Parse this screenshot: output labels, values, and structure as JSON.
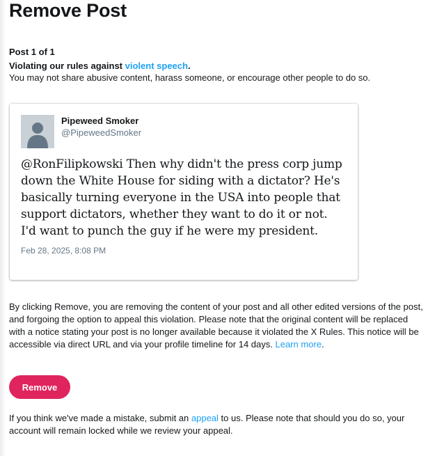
{
  "page": {
    "title": "Remove Post",
    "post_counter": "Post 1 of 1"
  },
  "rule": {
    "prefix": "Violating our rules against ",
    "link_text": "violent speech",
    "suffix": ".",
    "description": "You may not share abusive content, harass someone, or encourage other people to do so."
  },
  "tweet": {
    "author_name": "Pipeweed Smoker",
    "author_handle": "@PipeweedSmoker",
    "text": "@RonFilipkowski Then why didn't the press corp jump down the White House for siding with a dictator? He's basically turning everyone in the USA into people that support dictators, whether they want to do it or not. I'd want to punch the guy if he were my president.",
    "timestamp": "Feb 28, 2025, 8:08 PM",
    "avatar_icon": "default-avatar-icon"
  },
  "explanation": {
    "text": "By clicking Remove, you are removing the content of your post and all other edited versions of the post, and forgoing the option to appeal this violation. Please note that the original content will be replaced with a notice stating your post is no longer available because it violated the X Rules. This notice will be accessible via direct URL and via your profile timeline for 14 days. ",
    "learn_more": "Learn more",
    "learn_more_suffix": "."
  },
  "actions": {
    "remove_label": "Remove"
  },
  "appeal": {
    "prefix": "If you think we've made a mistake, submit an ",
    "link_text": "appeal",
    "suffix": " to us. Please note that should you do so, your account will remain locked while we review your appeal."
  },
  "colors": {
    "link": "#1da1f2",
    "remove_button": "#e0245e",
    "muted_text": "#657786",
    "avatar_bg": "#c9d0d6"
  }
}
